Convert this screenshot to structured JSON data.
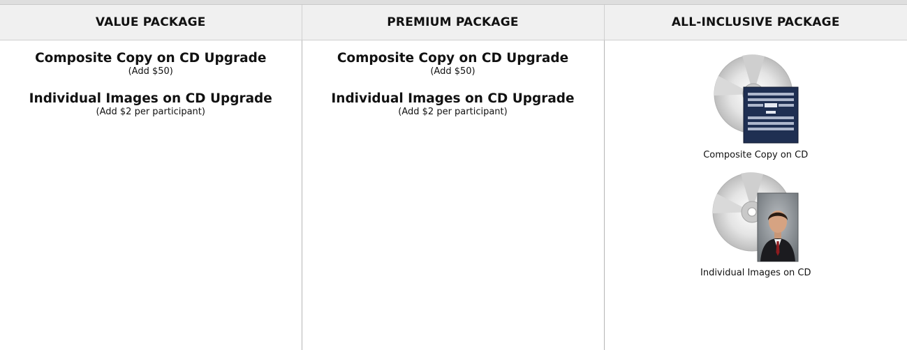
{
  "columns": [
    {
      "header": "VALUE PACKAGE",
      "upgrades": [
        {
          "title": "Composite Copy on CD Upgrade",
          "note": "(Add $50)"
        },
        {
          "title": "Individual Images on CD Upgrade",
          "note": "(Add $2 per participant)"
        }
      ]
    },
    {
      "header": "PREMIUM PACKAGE",
      "upgrades": [
        {
          "title": "Composite Copy on CD Upgrade",
          "note": "(Add $50)"
        },
        {
          "title": "Individual Images on CD Upgrade",
          "note": "(Add $2 per participant)"
        }
      ]
    },
    {
      "header": "ALL-INCLUSIVE PACKAGE",
      "items": [
        {
          "caption": "Composite Copy on CD",
          "image": "cd-with-composite-photo"
        },
        {
          "caption": "Individual Images on CD",
          "image": "cd-with-portrait-photo"
        }
      ]
    }
  ],
  "colors": {
    "header_bg": "#f0f0f0",
    "composite_bg": "#1f2f52",
    "portrait_bg": "#8a8f94"
  }
}
